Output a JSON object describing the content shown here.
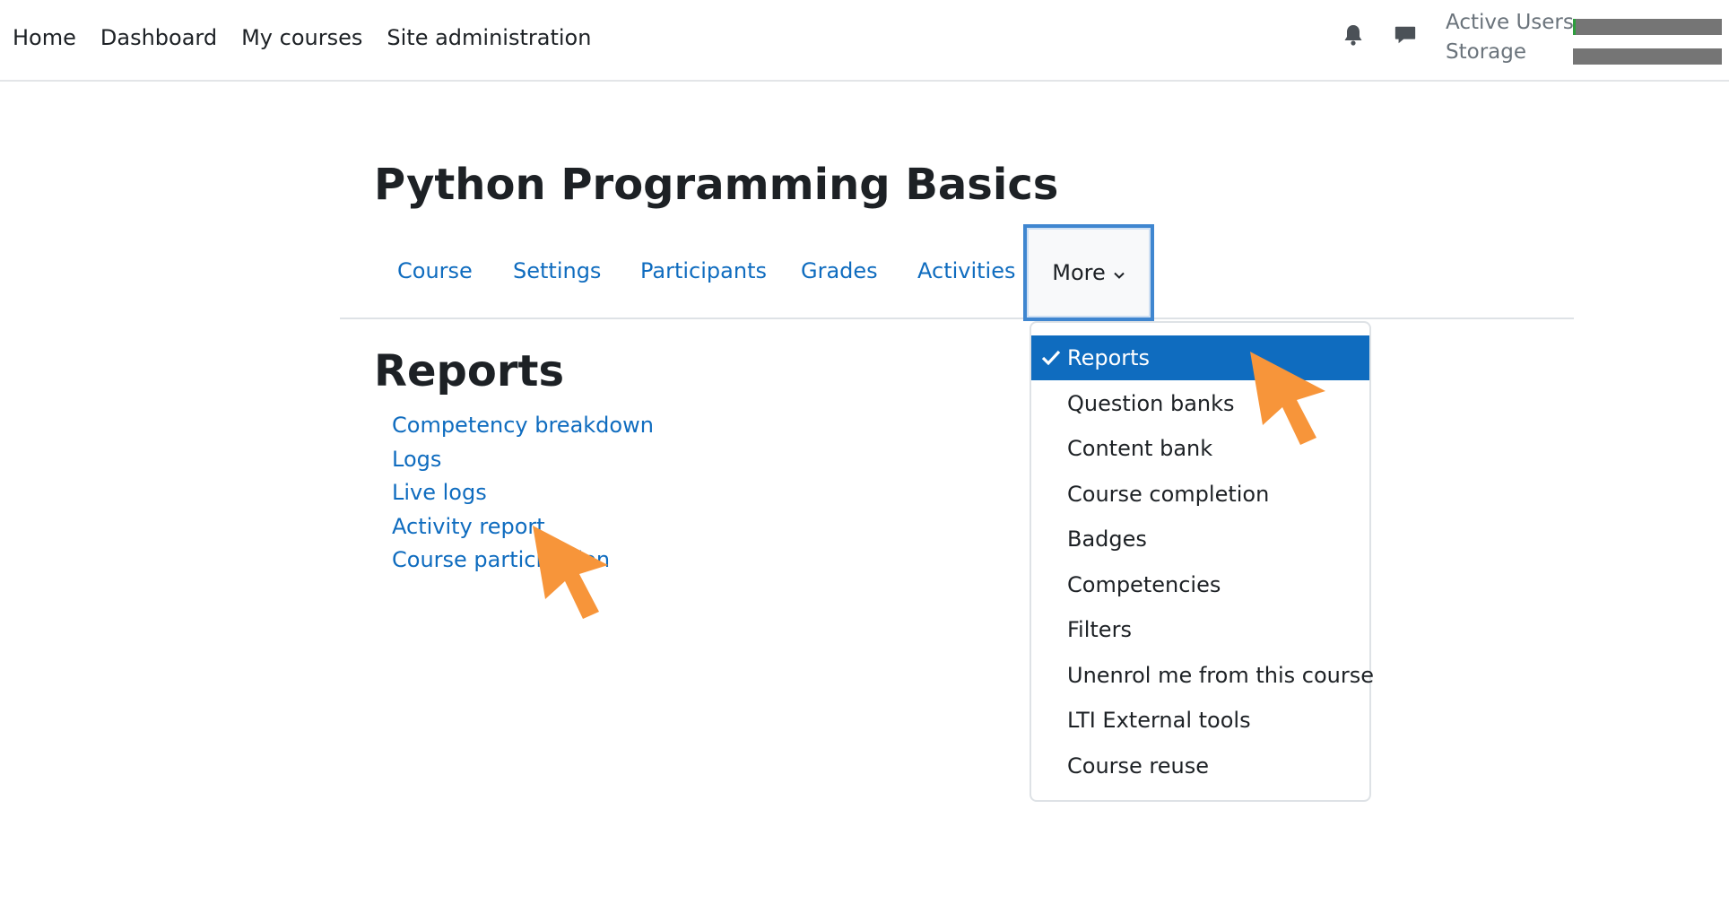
{
  "navbar": {
    "links": [
      "Home",
      "Dashboard",
      "My courses",
      "Site administration"
    ],
    "icons": [
      "bell-icon",
      "chat-icon"
    ],
    "stats": [
      {
        "label": "Active Users",
        "fill": 0.02,
        "fill_color": "#2e9e3e"
      },
      {
        "label": "Storage",
        "fill": 0.0,
        "fill_color": "#2e9e3e"
      }
    ]
  },
  "course": {
    "title": "Python Programming Basics",
    "tabs": [
      "Course",
      "Settings",
      "Participants",
      "Grades",
      "Activities"
    ],
    "more_label": "More"
  },
  "reports": {
    "heading": "Reports",
    "links": [
      "Competency breakdown",
      "Logs",
      "Live logs",
      "Activity report",
      "Course participation"
    ]
  },
  "more_menu": {
    "items": [
      {
        "label": "Reports",
        "selected": true
      },
      {
        "label": "Question banks",
        "selected": false
      },
      {
        "label": "Content bank",
        "selected": false
      },
      {
        "label": "Course completion",
        "selected": false
      },
      {
        "label": "Badges",
        "selected": false
      },
      {
        "label": "Competencies",
        "selected": false
      },
      {
        "label": "Filters",
        "selected": false
      },
      {
        "label": "Unenrol me from this course",
        "selected": false
      },
      {
        "label": "LTI External tools",
        "selected": false
      },
      {
        "label": "Course reuse",
        "selected": false
      }
    ]
  },
  "colors": {
    "link": "#0f6cbf",
    "active_bg": "#0f6cbf",
    "highlight_border": "#3f86d0",
    "cursor": "#f7953a"
  }
}
